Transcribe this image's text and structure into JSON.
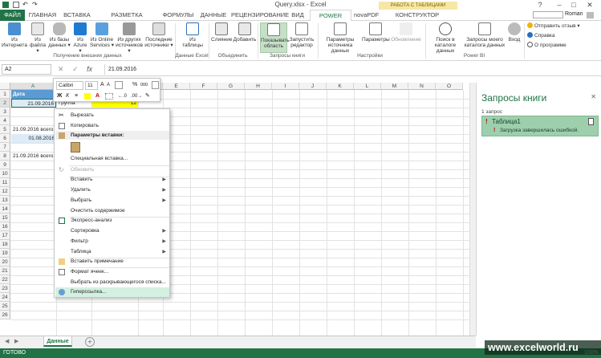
{
  "window": {
    "title": "Query.xlsx - Excel",
    "user": "Roman",
    "minimize": "–",
    "restore": "□",
    "close": "✕",
    "help": "?"
  },
  "colors": {
    "accent": "#217346",
    "selected_button": "#c6e0c8",
    "highlight_cell": "#ffff00",
    "ctx_tab": "#f7e7a6",
    "query_card": "#9ecfad"
  },
  "contextual_group": "РАБОТА С ТАБЛИЦАМИ",
  "tabs": [
    "ФАЙЛ",
    "ГЛАВНАЯ",
    "ВСТАВКА",
    "РАЗМЕТКА СТРАНИЦЫ",
    "ФОРМУЛЫ",
    "ДАННЫЕ",
    "РЕЦЕНЗИРОВАНИЕ",
    "ВИД",
    "POWER QUERY",
    "novaPDF",
    "КОНСТРУКТОР"
  ],
  "ribbon": {
    "buttons": [
      {
        "label": "Из Интернета"
      },
      {
        "label": "Из файла ▾"
      },
      {
        "label": "Из базы данных ▾"
      },
      {
        "label": "Из Azure ▾"
      },
      {
        "label": "Из Online Services ▾"
      },
      {
        "label": "Из других источников ▾"
      },
      {
        "label": "Последние источники ▾"
      },
      {
        "label": "Из таблицы"
      },
      {
        "label": "Слияние"
      },
      {
        "label": "Добавить"
      },
      {
        "label": "Показывать область"
      },
      {
        "label": "Запустить редактор"
      },
      {
        "label": "Параметры источника данных"
      },
      {
        "label": "Параметры"
      },
      {
        "label": "Обновление"
      },
      {
        "label": "Поиск в каталоге данных"
      },
      {
        "label": "Запросы моего каталога данных"
      },
      {
        "label": "Вход"
      }
    ],
    "groups": [
      "Получение внешних данных",
      "Данные Excel",
      "Объединить",
      "Запросы книги",
      "Настройки",
      "Power BI"
    ],
    "links": [
      "Отправить отзыв ▾",
      "Справка",
      "О программе"
    ]
  },
  "formula_bar": {
    "name_box": "A2",
    "value": "21.09.2016"
  },
  "grid": {
    "columns": [
      "A",
      "B",
      "C",
      "D",
      "E",
      "F",
      "G",
      "H",
      "I",
      "J",
      "K",
      "L",
      "M",
      "N",
      "O"
    ],
    "rows": [
      "1",
      "2",
      "3",
      "4",
      "5",
      "6",
      "7",
      "8",
      "9",
      "10",
      "11",
      "12",
      "13",
      "14",
      "15",
      "16",
      "17",
      "18",
      "19",
      "20",
      "21",
      "22",
      "23",
      "24",
      "25",
      "26"
    ],
    "cells": {
      "a1": "Дата",
      "a2": "21.09.2016",
      "b2": "Группа",
      "c2": "12",
      "a5": "21.09.2016 всего",
      "a6": "01.08.2016",
      "a8": "21.09.2016 всего"
    }
  },
  "minibar": {
    "font": "Calibri",
    "size": "11",
    "bold": "Ж",
    "italic": "К",
    "percent": "%",
    "thousands": "000"
  },
  "context_menu": {
    "cut": "Вырезать",
    "copy": "Копировать",
    "paste_options": "Параметры вставки:",
    "paste_special": "Специальная вставка...",
    "refresh": "Обновить",
    "insert": "Вставить",
    "delete": "Удалить",
    "select": "Выбрать",
    "clear": "Очистить содержимое",
    "quick_analysis": "Экспресс-анализ",
    "sort": "Сортировка",
    "filter": "Фильтр",
    "table": "Таблица",
    "insert_comment": "Вставить примечание",
    "format_cells": "Формат ячеек...",
    "pick_list": "Выбрать из раскрывающегося списка...",
    "hyperlink": "Гиперссылка..."
  },
  "pane": {
    "title": "Запросы книги",
    "count": "1 запрос",
    "query_name": "Таблица1",
    "query_error": "Загрузка завершилась ошибкой."
  },
  "sheet": {
    "tab": "Данные",
    "add": "+"
  },
  "status": {
    "ready": "ГОТОВО",
    "zoom": "100%"
  },
  "watermark": "www.excelworld.ru"
}
